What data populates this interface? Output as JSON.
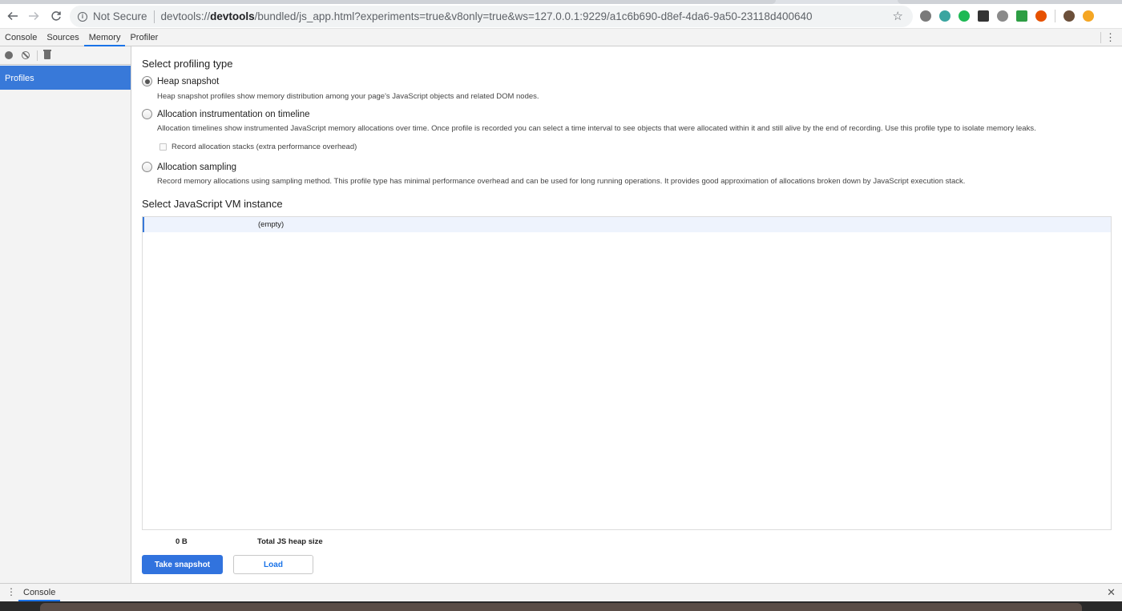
{
  "browser": {
    "security_label": "Not Secure",
    "url_scheme": "devtools://",
    "url_host": "devtools",
    "url_path": "/bundled/js_app.html?experiments=true&v8only=true&ws=127.0.0.1:9229/a1c6b690-d8ef-4da6-9a50-23118d400640",
    "extension_colors": [
      "#7a7a7a",
      "#3aa5a0",
      "#1db954",
      "#333333",
      "#8a8a8a",
      "#2e9e44",
      "#e65100",
      "#6b4f3a",
      "#f5a623"
    ]
  },
  "devtools": {
    "tabs": [
      "Console",
      "Sources",
      "Memory",
      "Profiler"
    ],
    "active_tab": "Memory"
  },
  "sidebar": {
    "items": [
      {
        "label": "Profiles",
        "selected": true
      }
    ]
  },
  "main": {
    "profiling_title": "Select profiling type",
    "options": [
      {
        "label": "Heap snapshot",
        "checked": true,
        "description": "Heap snapshot profiles show memory distribution among your page's JavaScript objects and related DOM nodes."
      },
      {
        "label": "Allocation instrumentation on timeline",
        "checked": false,
        "description": "Allocation timelines show instrumented JavaScript memory allocations over time. Once profile is recorded you can select a time interval to see objects that were allocated within it and still alive by the end of recording. Use this profile type to isolate memory leaks.",
        "checkbox_label": "Record allocation stacks (extra performance overhead)"
      },
      {
        "label": "Allocation sampling",
        "checked": false,
        "description": "Record memory allocations using sampling method. This profile type has minimal performance overhead and can be used for long running operations. It provides good approximation of allocations broken down by JavaScript execution stack."
      }
    ],
    "vm_title": "Select JavaScript VM instance",
    "vm_list": [
      "(empty)"
    ],
    "heap_size_value": "0 B",
    "heap_size_label": "Total JS heap size",
    "take_snapshot_label": "Take snapshot",
    "load_label": "Load"
  },
  "drawer": {
    "tab_label": "Console"
  }
}
